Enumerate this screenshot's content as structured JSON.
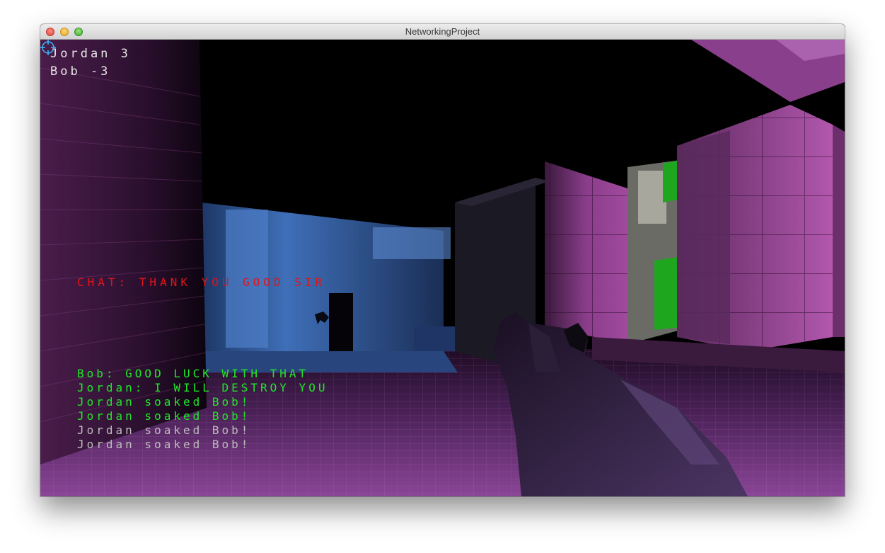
{
  "window": {
    "title": "NetworkingProject"
  },
  "scoreboard": [
    {
      "name": "Jordan",
      "score": "3",
      "text": "Jordan 3"
    },
    {
      "name": "Bob",
      "score": "-3",
      "text": "Bob -3"
    }
  ],
  "chat_input": {
    "text": "CHAT: THANK YOU GOOD SIR",
    "color": "#e0141b"
  },
  "message_log": [
    {
      "text": "Bob: GOOD LUCK WITH THAT",
      "kind": "chat",
      "color": "#22e62a"
    },
    {
      "text": "Jordan: I WILL DESTROY YOU",
      "kind": "chat",
      "color": "#22e62a"
    },
    {
      "text": "Jordan soaked Bob!",
      "kind": "kill",
      "color": "#22e62a"
    },
    {
      "text": "Jordan soaked Bob!",
      "kind": "kill",
      "color": "#22e62a"
    },
    {
      "text": "Jordan soaked Bob!",
      "kind": "kill",
      "color": "#bdbdbd"
    },
    {
      "text": "Jordan soaked Bob!",
      "kind": "kill",
      "color": "#bdbdbd"
    }
  ],
  "crosshair": {
    "icon": "crosshair-icon",
    "color": "#3ab7ff"
  },
  "scene_colors": {
    "purple_wall": "#7a2f7a",
    "blue_room": "#3f6fb8",
    "green_panel": "#1fa61f",
    "floor": "#7a3a86"
  }
}
